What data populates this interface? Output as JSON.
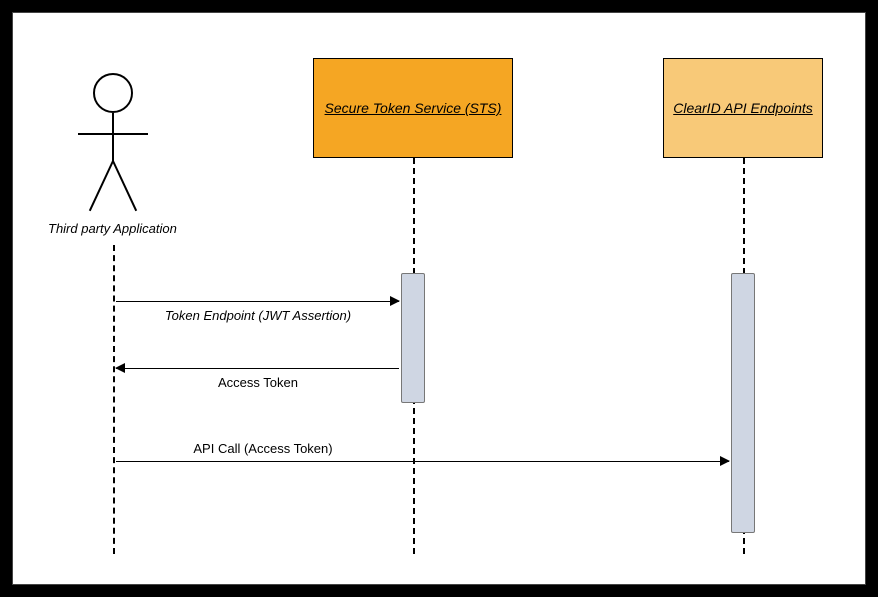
{
  "participants": {
    "client": {
      "label": "Third party Application"
    },
    "sts": {
      "label": "Secure Token Service (STS)"
    },
    "api": {
      "label": "ClearID API Endpoints"
    }
  },
  "messages": {
    "token_request": {
      "label": "Token Endpoint (JWT Assertion)"
    },
    "access_token": {
      "label": "Access Token"
    },
    "api_call": {
      "label": "API Call (Access Token)"
    }
  },
  "chart_data": {
    "type": "sequence-diagram",
    "participants": [
      {
        "id": "client",
        "name": "Third party Application",
        "kind": "actor"
      },
      {
        "id": "sts",
        "name": "Secure Token Service (STS)",
        "kind": "system",
        "color": "#f5a623"
      },
      {
        "id": "api",
        "name": "ClearID API Endpoints",
        "kind": "system",
        "color": "#f8c978"
      }
    ],
    "messages": [
      {
        "from": "client",
        "to": "sts",
        "label": "Token Endpoint (JWT Assertion)",
        "direction": "request"
      },
      {
        "from": "sts",
        "to": "client",
        "label": "Access Token",
        "direction": "response"
      },
      {
        "from": "client",
        "to": "api",
        "label": "API Call (Access Token)",
        "direction": "request"
      }
    ],
    "activations": [
      {
        "participant": "sts",
        "from_msg": 0,
        "to_msg": 1
      },
      {
        "participant": "api",
        "from_msg": 0,
        "to_msg": 2
      }
    ]
  }
}
